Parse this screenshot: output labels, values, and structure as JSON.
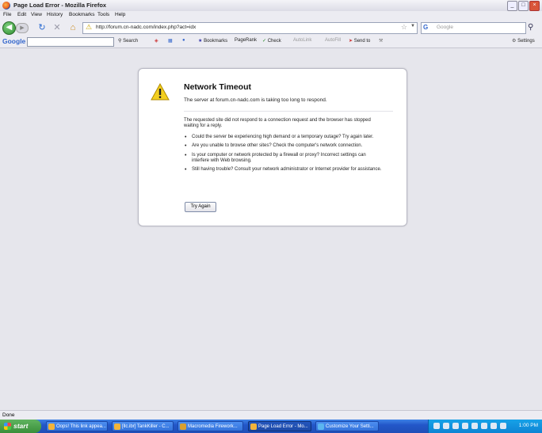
{
  "window": {
    "title": "Page Load Error - Mozilla Firefox",
    "controls": [
      "_",
      "□",
      "×"
    ]
  },
  "menu": [
    "File",
    "Edit",
    "View",
    "History",
    "Bookmarks",
    "Tools",
    "Help"
  ],
  "navbar": {
    "url": "http://forum.cn-nadc.com/index.php?act=idx",
    "search_placeholder": "Google"
  },
  "google_toolbar": {
    "logo": "Google",
    "items": [
      "Search",
      "Bookmarks",
      "PageRank",
      "Check",
      "AutoLink",
      "AutoFill",
      "Send to",
      "Settings"
    ]
  },
  "error": {
    "title": "Network Timeout",
    "short_desc": "The server at forum.cn-nadc.com is taking too long to respond.",
    "long_desc": "The requested site did not respond to a connection request and the browser has stopped waiting for a reply.",
    "bullets": [
      "Could the server be experiencing high demand or a temporary outage? Try again later.",
      "Are you unable to browse other sites? Check the computer's network connection.",
      "Is your computer or network protected by a firewall or proxy? Incorrect settings can interfere with Web browsing.",
      "Still having trouble? Consult your network administrator or Internet provider for assistance."
    ],
    "button": "Try Again"
  },
  "status": "Done",
  "taskbar": {
    "start": "start",
    "tasks": [
      "Oops! This link appea...",
      "[llc.ibr] TankKiller - C...",
      "Macromedia Firework...",
      "Page Load Error - Mo...",
      "Customize Your Setti..."
    ],
    "active_task": 3,
    "clock": "1:00 PM"
  }
}
